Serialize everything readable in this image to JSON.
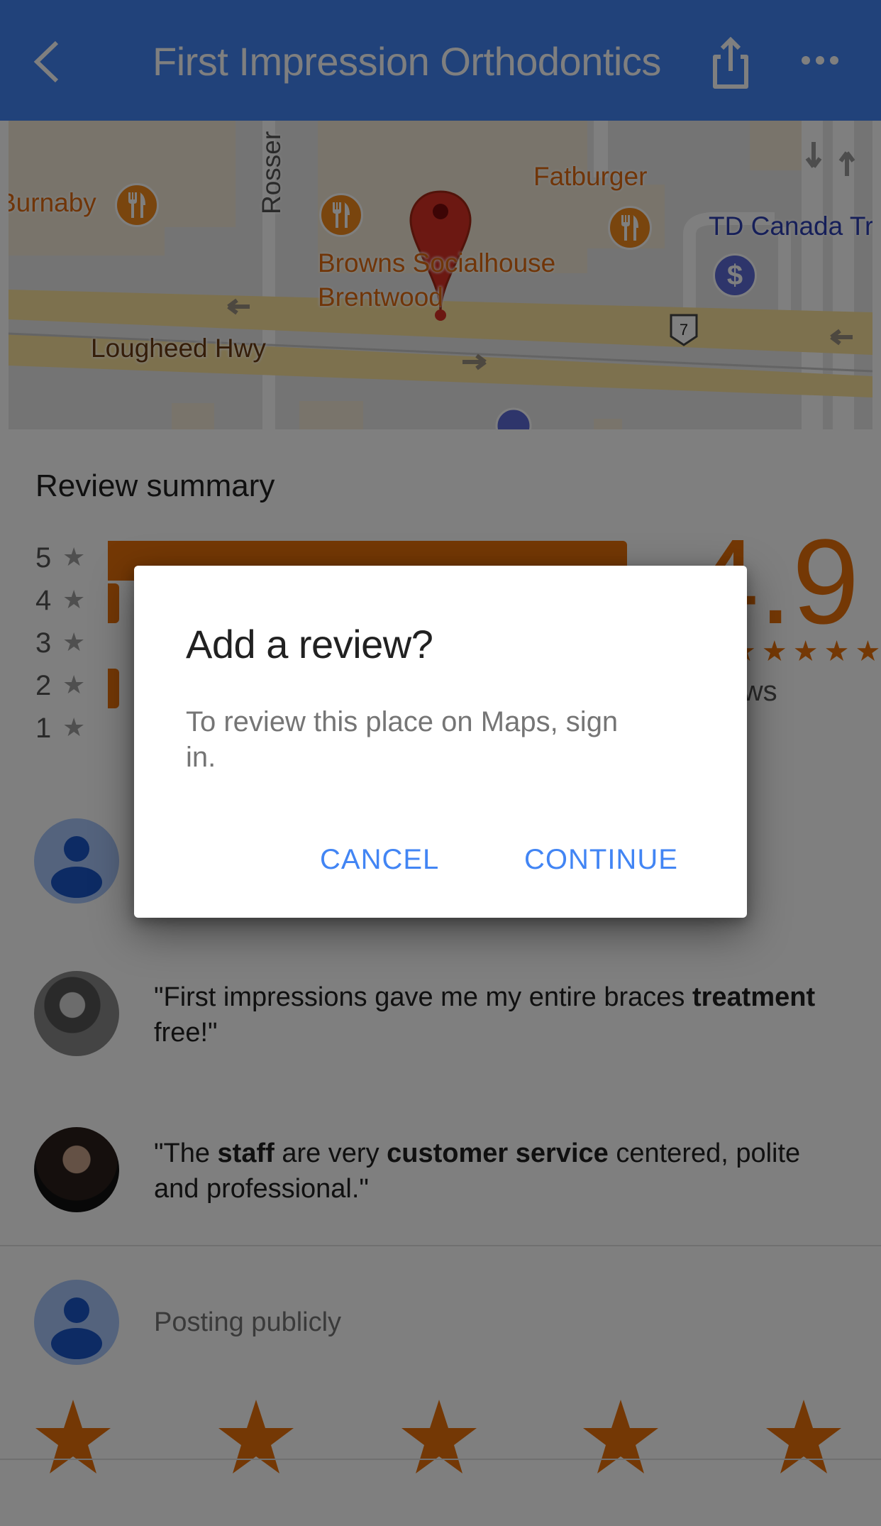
{
  "app_bar": {
    "title": "First Impression Orthodontics",
    "back_icon": "chevron-left-icon",
    "share_icon": "share-icon",
    "more_icon": "more-horizontal-icon"
  },
  "map": {
    "labels": {
      "burnaby": "Burnaby",
      "rosser": "Rosser",
      "fatburger": "Fatburger",
      "browns_line1": "Browns Socialhouse",
      "browns_line2": "Brentwood",
      "td": "TD Canada Trust",
      "lougheed": "Lougheed Hwy",
      "highway_number": "7"
    },
    "colors": {
      "food": "#e8710a",
      "bank": "#5c6bd6",
      "pin": "#c5221f"
    }
  },
  "review_summary": {
    "title": "Review summary",
    "rating": "4.9",
    "stars": "★★★★★",
    "reviews_label": "reviews",
    "histogram": [
      {
        "stars": "5",
        "fraction": 1.0
      },
      {
        "stars": "4",
        "fraction": 0.02
      },
      {
        "stars": "3",
        "fraction": 0.0
      },
      {
        "stars": "2",
        "fraction": 0.02
      },
      {
        "stars": "1",
        "fraction": 0.0
      }
    ],
    "star_glyph": "★",
    "accent": "#e8710a"
  },
  "reviews": [
    {
      "quote_pre": "\"First impressions gave me my entire braces ",
      "quote_bold1": "treatment",
      "quote_mid": " free!\"",
      "quote_bold2": "",
      "quote_post": ""
    },
    {
      "quote_pre": "\"The ",
      "quote_bold1": "staff",
      "quote_mid": " are very ",
      "quote_bold2": "customer service",
      "quote_post": " centered, polite and professional.\""
    }
  ],
  "compose": {
    "posting_label": "Posting publicly",
    "rating_stars": 5,
    "selected": 0
  },
  "dialog": {
    "title": "Add a review?",
    "body": "To review this place on Maps, sign in.",
    "cancel_label": "CANCEL",
    "continue_label": "CONTINUE",
    "button_color": "#4285f4"
  }
}
